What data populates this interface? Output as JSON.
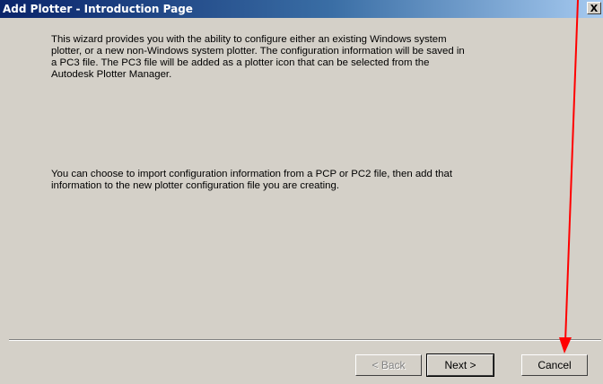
{
  "window": {
    "title": "Add Plotter - Introduction Page",
    "close_glyph": "X"
  },
  "content": {
    "paragraph1": "This wizard provides you with the ability to configure either an existing Windows system plotter, or a new non-Windows system plotter. The configuration information will be saved in a PC3 file. The PC3 file will be added as a plotter icon that can be selected from the Autodesk Plotter Manager.",
    "paragraph2": "You can choose to import configuration information from a PCP or PC2 file, then add that information to the new plotter configuration file you are creating."
  },
  "buttons": {
    "back": "< Back",
    "next": "Next >",
    "cancel": "Cancel"
  },
  "colors": {
    "title_gradient_start": "#0a246a",
    "title_gradient_end": "#a6caf0",
    "dialog_background": "#d4d0c8",
    "annotation_arrow": "#ff0000"
  },
  "icons": {
    "close": "close-icon",
    "annotation": "red-arrow-annotation"
  }
}
